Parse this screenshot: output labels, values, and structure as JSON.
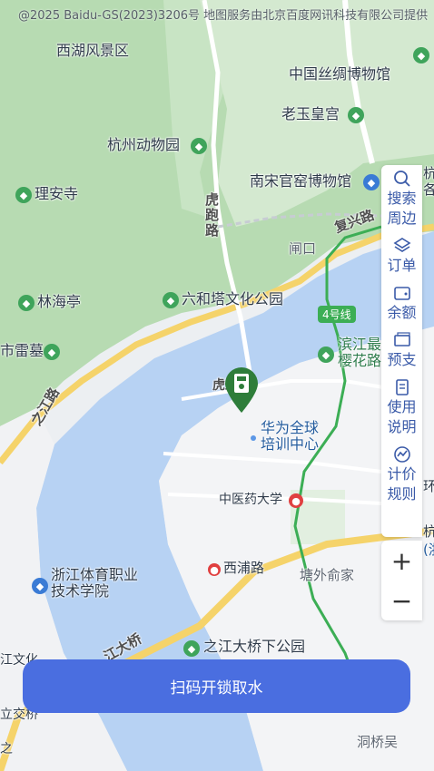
{
  "map": {
    "copyright": "@2025 Baidu-GS(2023)3206号 地图服务由北京百度网讯科技有限公司提供",
    "areas": {
      "west_lake": "西湖风景区",
      "silk_museum": "中国丝绸博物馆",
      "laoyu": "老玉皇宫",
      "zoo": "杭州动物园",
      "guanyao": "南宋官窑博物馆",
      "lian": "理安寺",
      "linhai": "林海亭",
      "liuhe": "六和塔文化公园",
      "leimu": "市雷墓",
      "huawei": "华为全球培训中心",
      "binjiang": "滨江最樱花路",
      "zjsport": "浙江体育职业技术学院",
      "xipu": "西浦路",
      "tangwai": "塘外俞家",
      "zjpark": "之江大桥下公园",
      "zjwh": "江文化",
      "ljq": "立交桥",
      "dqw": "洞桥吴",
      "zhi": "之",
      "zha": "闸口",
      "zyd": "中医药大学",
      "hang": "杭",
      "gai": "各",
      "huan": "环",
      "zhe": "杭",
      "zhe2": "(浙"
    },
    "roads": {
      "hupao": "虎跑路",
      "fuxing": "复兴路",
      "zhijiang": "之江路",
      "line4": "4号线",
      "daqiao": "江大桥",
      "tingpao": "虎路"
    }
  },
  "toolbar": {
    "items": [
      {
        "label": "搜索周边",
        "icon": "search-icon"
      },
      {
        "label": "订单",
        "icon": "layers-icon"
      },
      {
        "label": "余额",
        "icon": "wallet-icon"
      },
      {
        "label": "预支",
        "icon": "cash-icon"
      },
      {
        "label": "使用说明",
        "icon": "document-icon"
      },
      {
        "label": "计价规则",
        "icon": "chart-icon"
      }
    ],
    "zoom_in": "+",
    "zoom_out": "−"
  },
  "action": {
    "scan_label": "扫码开锁取水"
  },
  "colors": {
    "accent": "#4a6ee0",
    "green_area": "#b9dcb6",
    "river": "#b9d3f5",
    "metro": "#3cae55",
    "road_yellow": "#f5d36a"
  }
}
